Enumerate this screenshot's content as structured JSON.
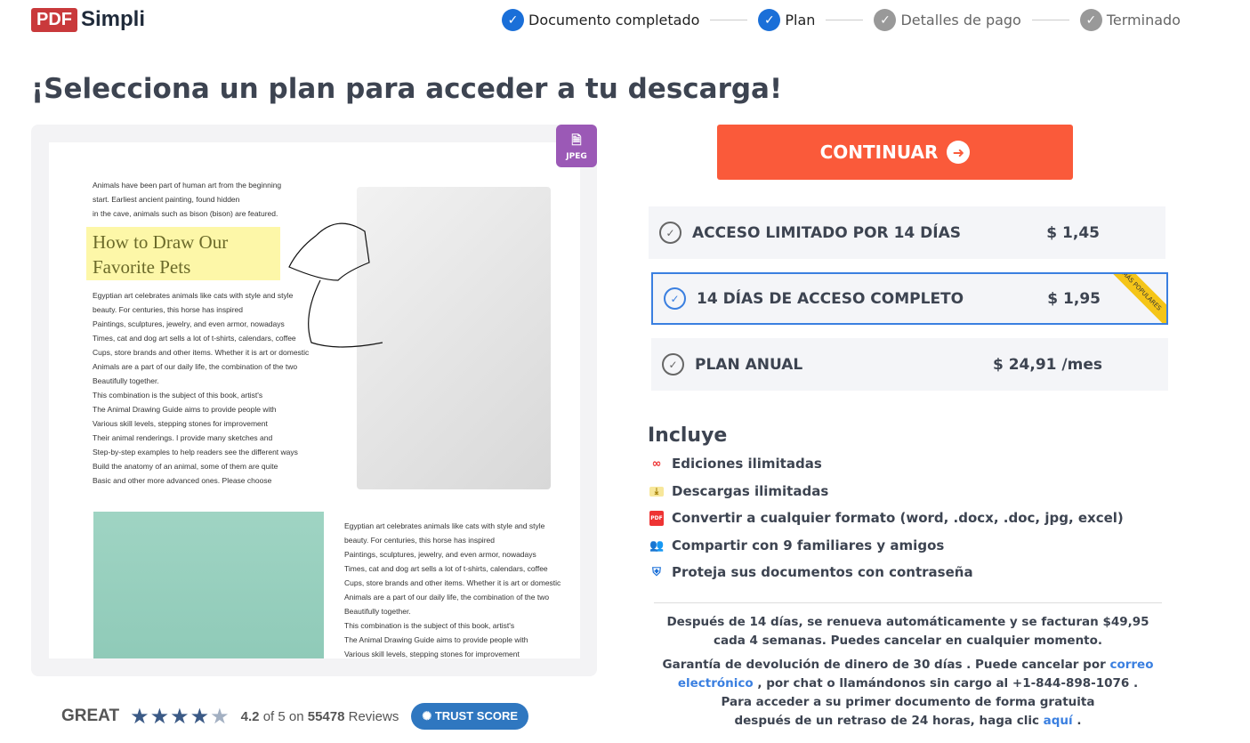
{
  "logo": {
    "pdf": "PDF",
    "simpli": "Simpli"
  },
  "steps": [
    {
      "label": "Documento completado",
      "done": true
    },
    {
      "label": "Plan",
      "done": true
    },
    {
      "label": "Detalles de pago",
      "done": false
    },
    {
      "label": "Terminado",
      "done": false
    }
  ],
  "title": "¡Selecciona un plan para acceder a tu descarga!",
  "preview": {
    "badge": "JPEG",
    "intro": [
      "Animals have been part of human art from the beginning",
      "start. Earliest ancient painting, found hidden",
      "in the cave, animals such as bison (bison) are featured."
    ],
    "heading": [
      "How to Draw Our",
      "Favorite Pets"
    ],
    "body": [
      "Egyptian art celebrates animals like cats with style and style",
      "beauty. For centuries, this horse has inspired",
      "Paintings, sculptures, jewelry, and even armor, nowadays",
      "Times, cat and dog art sells a lot of t-shirts, calendars, coffee",
      "Cups, store brands and other items. Whether it is art or domestic",
      "Animals are a part of our daily life, the combination of the two",
      "Beautifully together.",
      "This combination is the subject of this book, artist's",
      "The Animal Drawing Guide aims to provide people with",
      "Various skill levels, stepping stones for improvement",
      "Their animal renderings. I provide many sketches and",
      "Step-by-step examples to help readers see the different ways",
      "Build the anatomy of an animal, some of them are quite",
      "Basic and other more advanced ones. Please choose"
    ],
    "body2": [
      "Egyptian art celebrates animals like cats with style and style",
      "beauty. For centuries, this horse has inspired",
      "Paintings, sculptures, jewelry, and even armor, nowadays",
      "Times, cat and dog art sells a lot of t-shirts, calendars, coffee",
      "Cups, store brands and other items. Whether it is art or domestic",
      "Animals are a part of our daily life, the combination of the two",
      "Beautifully together.",
      "This combination is the subject of this book, artist's",
      "The Animal Drawing Guide aims to provide people with",
      "Various skill levels, stepping stones for improvement"
    ]
  },
  "continue_label": "CONTINUAR",
  "plans": [
    {
      "name": "ACCESO LIMITADO POR 14 DÍAS",
      "price": "$ 1,45",
      "selected": false
    },
    {
      "name": "14 DÍAS DE ACCESO COMPLETO",
      "price": "$ 1,95",
      "selected": true,
      "ribbon": "MÁS POPULARES"
    },
    {
      "name": "PLAN ANUAL",
      "price": "$ 24,91 /mes",
      "selected": false
    }
  ],
  "includes": {
    "title": "Incluye",
    "items": [
      {
        "icon": "infinity-icon",
        "label": "Ediciones ilimitadas"
      },
      {
        "icon": "download-file-icon",
        "label": "Descargas ilimitadas"
      },
      {
        "icon": "pdf-file-icon",
        "label": "Convertir a cualquier formato (word, .docx, .doc, jpg, excel)"
      },
      {
        "icon": "people-icon",
        "label": "Compartir con 9 familiares y amigos"
      },
      {
        "icon": "shield-icon",
        "label": "Proteja sus documentos con contraseña"
      }
    ]
  },
  "disclaimer": {
    "renewal": "Después de 14 días, se renueva automáticamente y se facturan $49,95 cada 4 semanas. Puedes cancelar en cualquier momento.",
    "g1": "Garantía de devolución de dinero de 30 días . Puede cancelar por ",
    "email_link": "correo electrónico",
    "g2": " , por chat o llamándonos sin cargo al +1-844-898-1076 .",
    "g3": "Para acceder a su primer documento de forma gratuita",
    "g4": "después de un retraso de 24 horas, haga clic ",
    "here_link": "aquí",
    "g5": " ."
  },
  "trust": {
    "rating_word": "GREAT",
    "score": "4.2",
    "of": " of 5 on ",
    "count": "55478",
    "reviews": " Reviews",
    "stars": 4.2,
    "badge": "TRUST SCORE"
  },
  "colors": {
    "accent": "#fa5a3a",
    "primary": "#1a6fd8",
    "selected_border": "#3a7fe0",
    "ribbon": "#f5c518",
    "jpeg_badge": "#9b59b6"
  }
}
